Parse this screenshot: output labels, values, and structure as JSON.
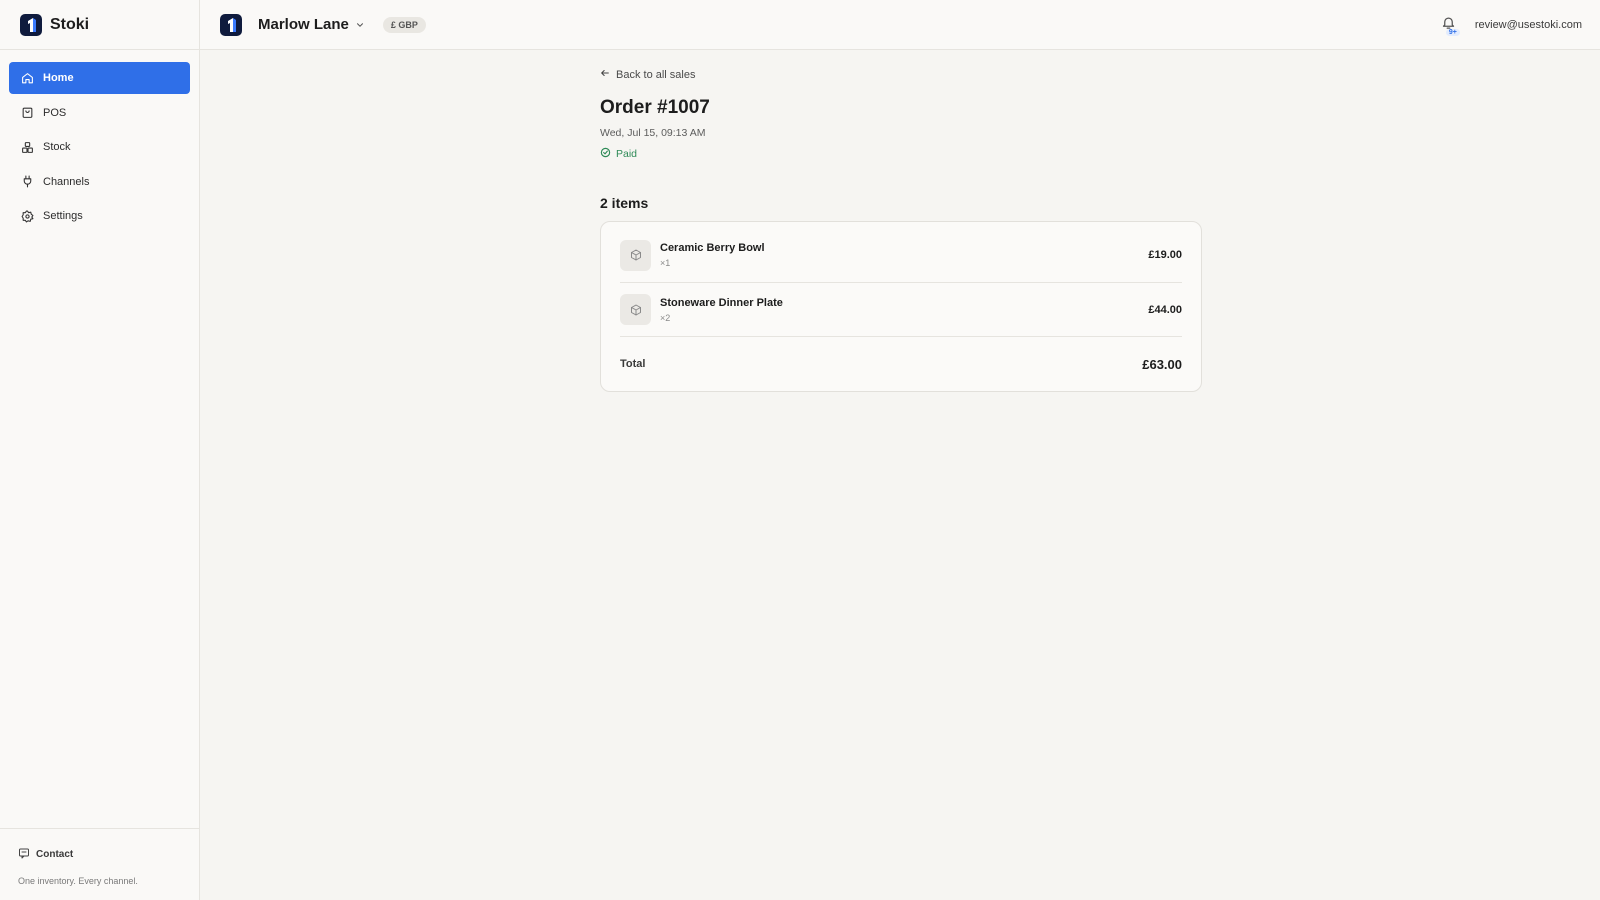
{
  "app": {
    "name": "Stoki"
  },
  "sidebar": {
    "items": [
      {
        "label": "Home",
        "icon": "home-icon",
        "active": true
      },
      {
        "label": "POS",
        "icon": "shopping-bag-icon",
        "active": false
      },
      {
        "label": "Stock",
        "icon": "boxes-icon",
        "active": false
      },
      {
        "label": "Channels",
        "icon": "plug-icon",
        "active": false
      },
      {
        "label": "Settings",
        "icon": "gear-icon",
        "active": false
      }
    ],
    "contact_label": "Contact",
    "tagline": "One inventory. Every channel."
  },
  "topbar": {
    "store_name": "Marlow Lane",
    "currency": "£ GBP",
    "notification_count": "9+",
    "user_email": "review@usestoki.com"
  },
  "order": {
    "back_label": "Back to all sales",
    "title": "Order #1007",
    "date": "Wed, Jul 15, 09:13 AM",
    "status": "Paid",
    "items_heading": "2 items",
    "items": [
      {
        "name": "Ceramic Berry Bowl",
        "qty": "×1",
        "price": "£19.00"
      },
      {
        "name": "Stoneware Dinner Plate",
        "qty": "×2",
        "price": "£44.00"
      }
    ],
    "total_label": "Total",
    "total_value": "£63.00"
  },
  "colors": {
    "accent": "#2f6fe8",
    "paid": "#2e8a57",
    "logo": "#0f1b3d"
  }
}
